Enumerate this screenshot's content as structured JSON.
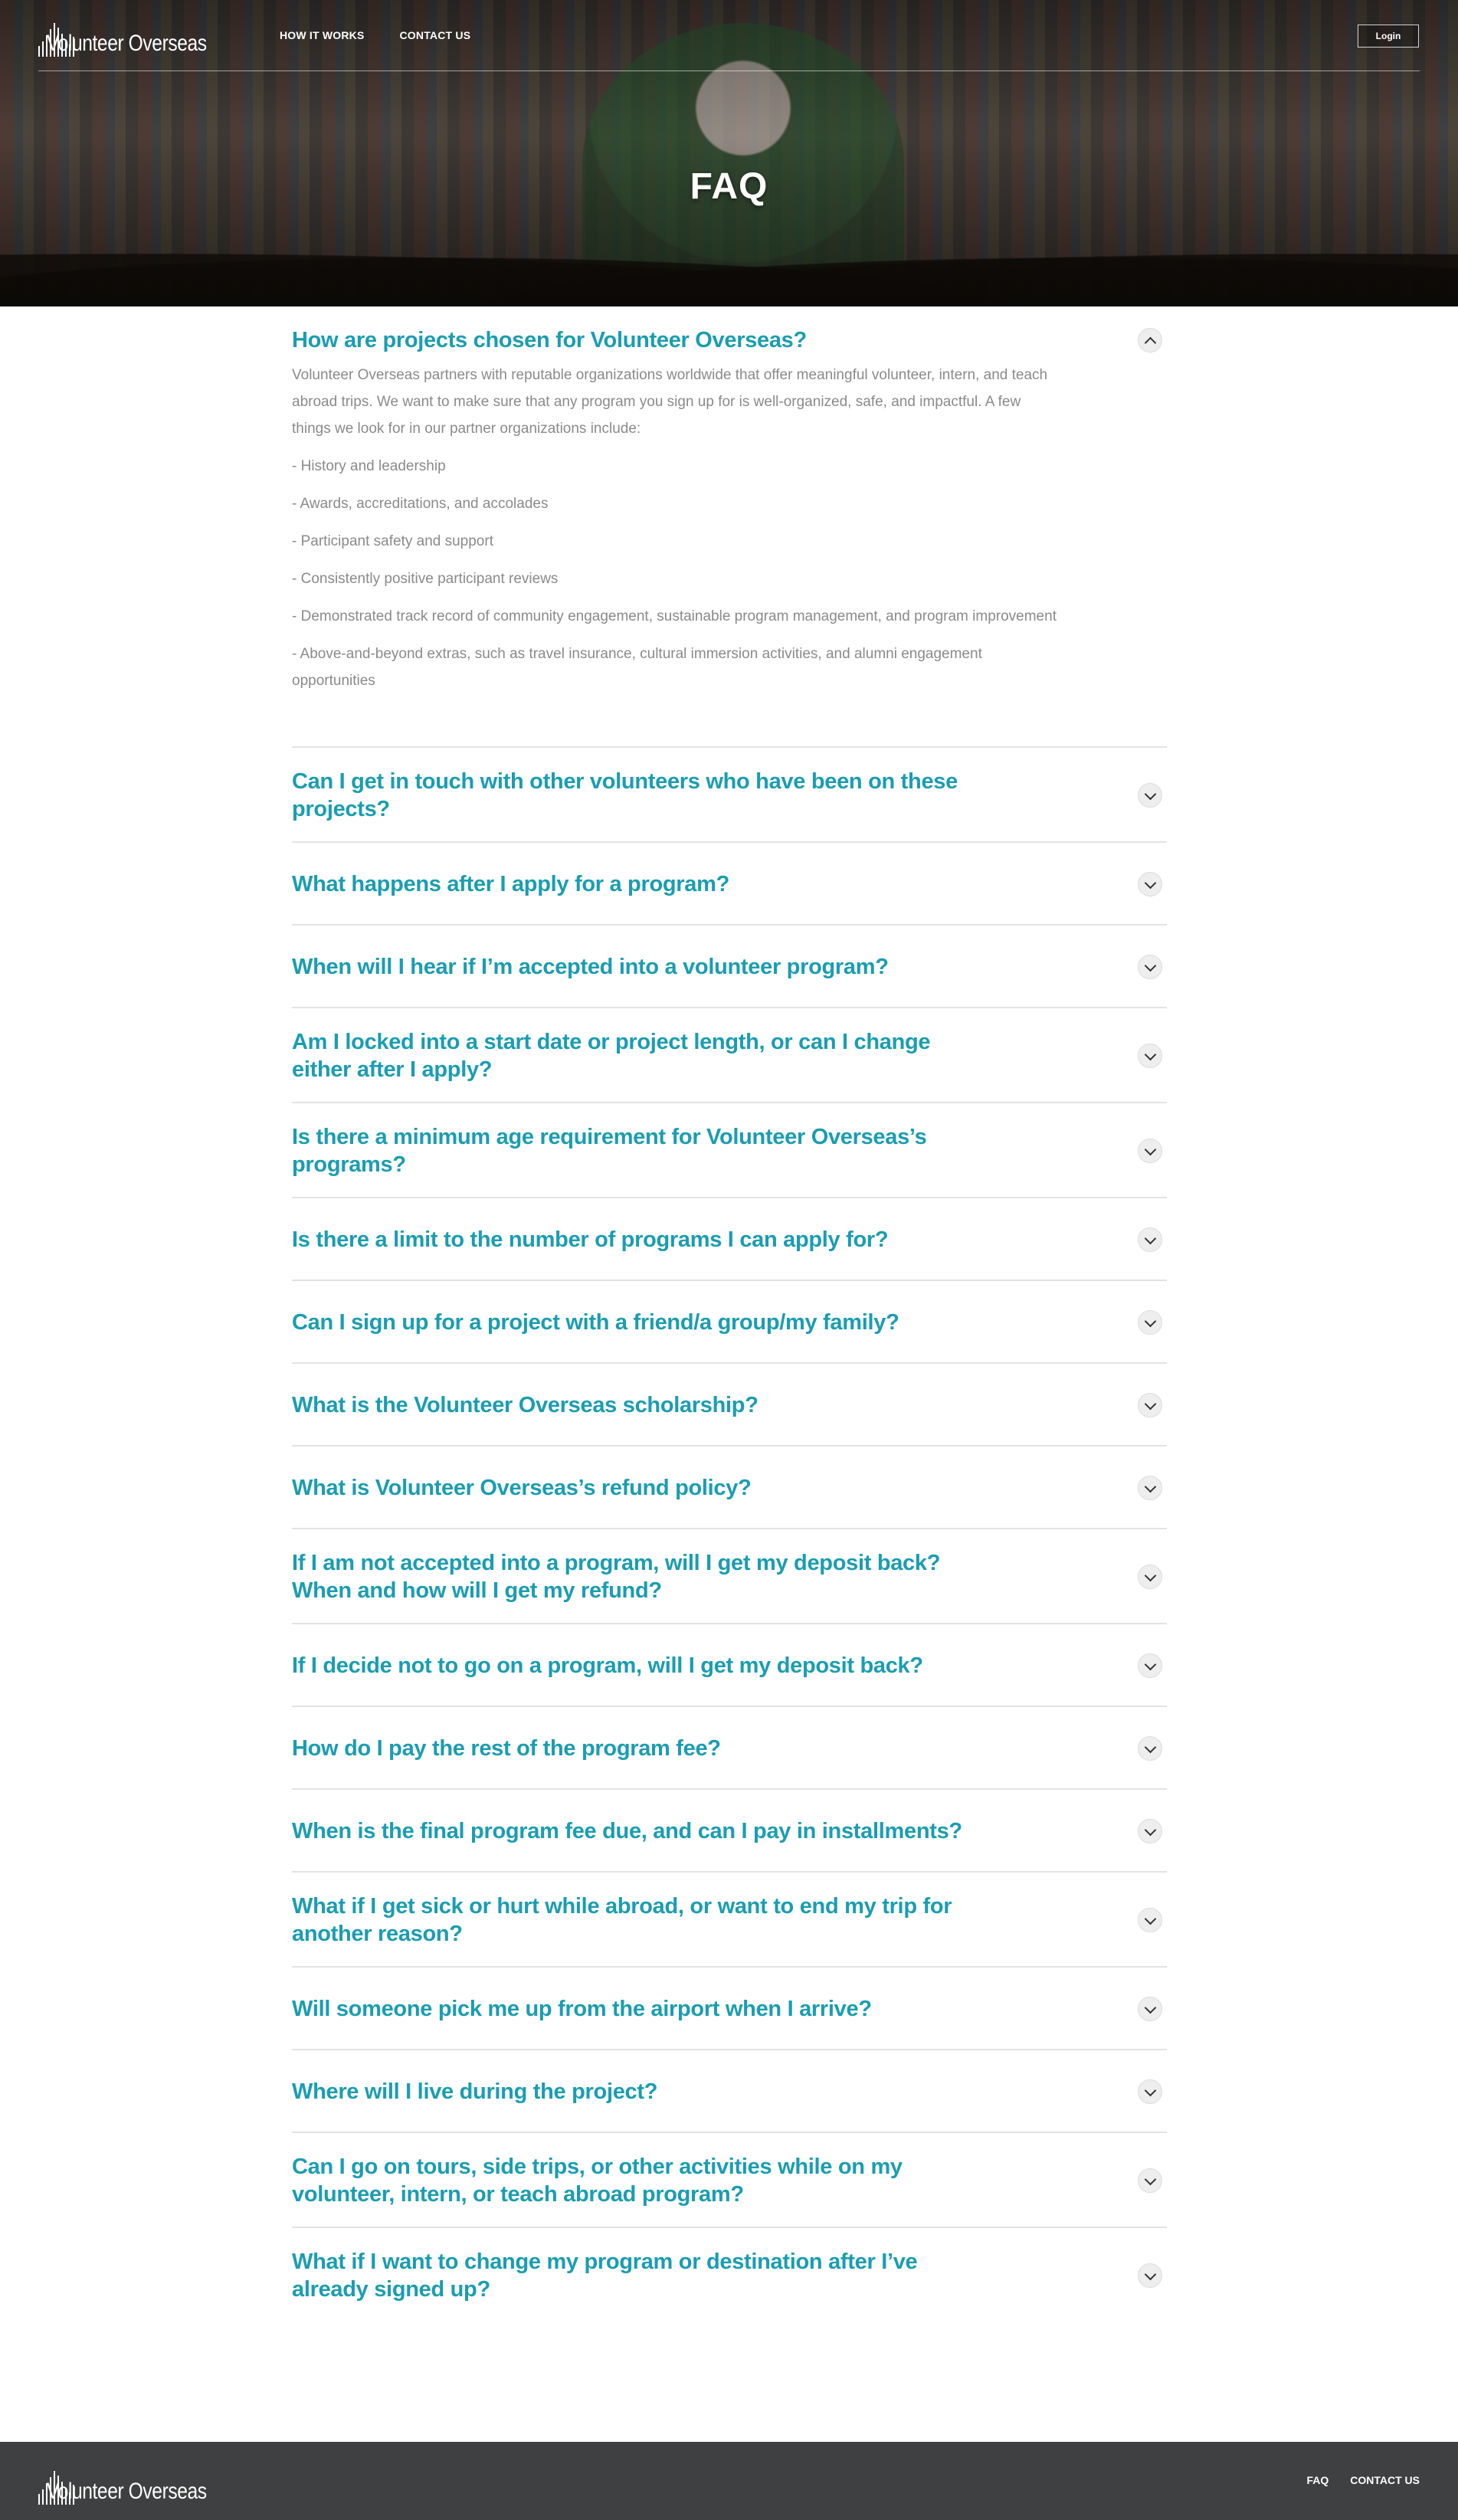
{
  "brand": {
    "name": "Volunteer Overseas"
  },
  "nav": {
    "how_it_works": "HOW IT WORKS",
    "contact_us": "CONTACT US",
    "login": "Login"
  },
  "hero": {
    "title": "FAQ"
  },
  "faq": {
    "open_item": {
      "question": "How are projects chosen for Volunteer Overseas?",
      "intro": "Volunteer Overseas partners with reputable organizations worldwide that offer meaningful volunteer, intern, and teach abroad trips. We want to make sure that any program you sign up for is well-organized, safe, and impactful. A few things we look for in our partner organizations include:",
      "bullets": [
        "- History and leadership",
        "- Awards, accreditations, and accolades",
        "- Participant safety and support",
        "- Consistently positive participant reviews",
        "- Demonstrated track record of community engagement, sustainable program management, and program improvement",
        "- Above-and-beyond extras, such as travel insurance, cultural immersion activities, and alumni engagement opportunities"
      ]
    },
    "questions": [
      "Can I get in touch with other volunteers who have been on these projects?",
      "What happens after I apply for a program?",
      "When will I hear if I’m accepted into a volunteer program?",
      "Am I locked into a start date or project length, or can I change either after I apply?",
      "Is there a minimum age requirement for Volunteer Overseas’s programs?",
      "Is there a limit to the number of programs I can apply for?",
      "Can I sign up for a project with a friend/a group/my family?",
      "What is the Volunteer Overseas scholarship?",
      "What is Volunteer Overseas’s refund policy?",
      "If I am not accepted into a program, will I get my deposit back? When and how will I get my refund?",
      "If I decide not to go on a program, will I get my deposit back?",
      "How do I pay the rest of the program fee?",
      "When is the final program fee due, and can I pay in installments?",
      "What if I get sick or hurt while abroad, or want to end my trip for another reason?",
      "Will someone pick me up from the airport when I arrive?",
      "Where will I live during the project?",
      "Can I go on tours, side trips, or other activities while on my volunteer, intern, or teach abroad program?",
      "What if I want to change my program or destination after I’ve already signed up?"
    ]
  },
  "footer": {
    "faq": "FAQ",
    "contact_us": "CONTACT US"
  },
  "colors": {
    "accent": "#1a9db1",
    "answer_text": "#8a8a8a",
    "footer_bg": "#3f4041"
  }
}
